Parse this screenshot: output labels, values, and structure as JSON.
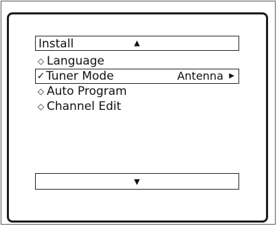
{
  "menu": {
    "title": "Install",
    "up_icon": "▲",
    "down_icon": "▼",
    "items": [
      {
        "label": "Language",
        "marker": "◇",
        "selected": false
      },
      {
        "label": "Tuner Mode",
        "marker": "✓",
        "selected": true,
        "value": "Antenna",
        "value_icon": "▶"
      },
      {
        "label": "Auto Program",
        "marker": "◇",
        "selected": false
      },
      {
        "label": "Channel Edit",
        "marker": "◇",
        "selected": false
      }
    ]
  }
}
